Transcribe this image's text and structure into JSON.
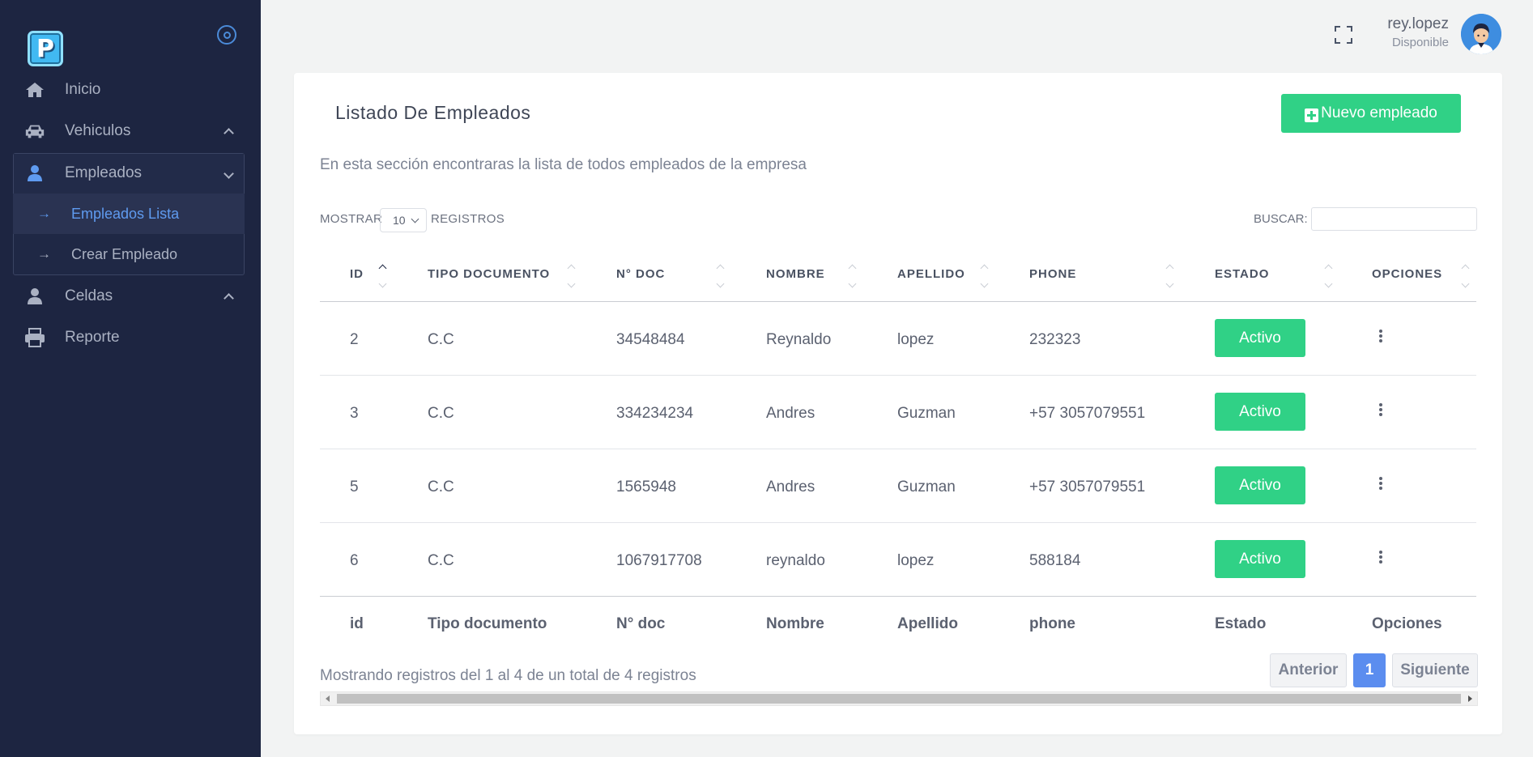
{
  "sidebar": {
    "logo_letter": "P",
    "items": [
      {
        "label": "Inicio",
        "icon": "home-icon"
      },
      {
        "label": "Vehiculos",
        "icon": "car-icon"
      },
      {
        "label": "Empleados",
        "icon": "user-icon"
      },
      {
        "label": "Celdas",
        "icon": "user-icon"
      },
      {
        "label": "Reporte",
        "icon": "printer-icon"
      }
    ],
    "submenu": [
      {
        "label": "Empleados Lista",
        "active": true
      },
      {
        "label": "Crear Empleado",
        "active": false
      }
    ],
    "arrow_glyph": "→"
  },
  "header": {
    "user_name": "rey.lopez",
    "user_status": "Disponible"
  },
  "card": {
    "title": "Listado De Empleados",
    "new_button": "Nuevo empleado",
    "description": "En esta sección encontraras la lista de todos empleados de la empresa",
    "show_label": "MOSTRAR",
    "page_size": "10",
    "records_label": "REGISTROS",
    "search_label": "BUSCAR:",
    "search_value": ""
  },
  "table": {
    "headers": [
      "ID",
      "TIPO DOCUMENTO",
      "N° DOC",
      "NOMBRE",
      "APELLIDO",
      "PHONE",
      "ESTADO",
      "OPCIONES"
    ],
    "rows": [
      {
        "id": "2",
        "tipo": "C.C",
        "doc": "34548484",
        "nombre": "Reynaldo",
        "apellido": "lopez",
        "phone": "232323",
        "estado": "Activo"
      },
      {
        "id": "3",
        "tipo": "C.C",
        "doc": "334234234",
        "nombre": "Andres",
        "apellido": "Guzman",
        "phone": "+57 3057079551",
        "estado": "Activo"
      },
      {
        "id": "5",
        "tipo": "C.C",
        "doc": "1565948",
        "nombre": "Andres",
        "apellido": "Guzman",
        "phone": "+57 3057079551",
        "estado": "Activo"
      },
      {
        "id": "6",
        "tipo": "C.C",
        "doc": "1067917708",
        "nombre": "reynaldo",
        "apellido": "lopez",
        "phone": "588184",
        "estado": "Activo"
      }
    ],
    "footers": [
      "id",
      "Tipo documento",
      "N° doc",
      "Nombre",
      "Apellido",
      "phone",
      "Estado",
      "Opciones"
    ],
    "sorted_column": "ID",
    "sort_direction": "asc"
  },
  "pagination": {
    "info": "Mostrando registros del 1 al 4 de un total de 4 registros",
    "prev": "Anterior",
    "current": "1",
    "next": "Siguiente"
  },
  "colors": {
    "sidebar_bg": "#1d2541",
    "accent_green": "#30d186",
    "accent_blue": "#5b8def",
    "active_link": "#5f9bf0"
  }
}
